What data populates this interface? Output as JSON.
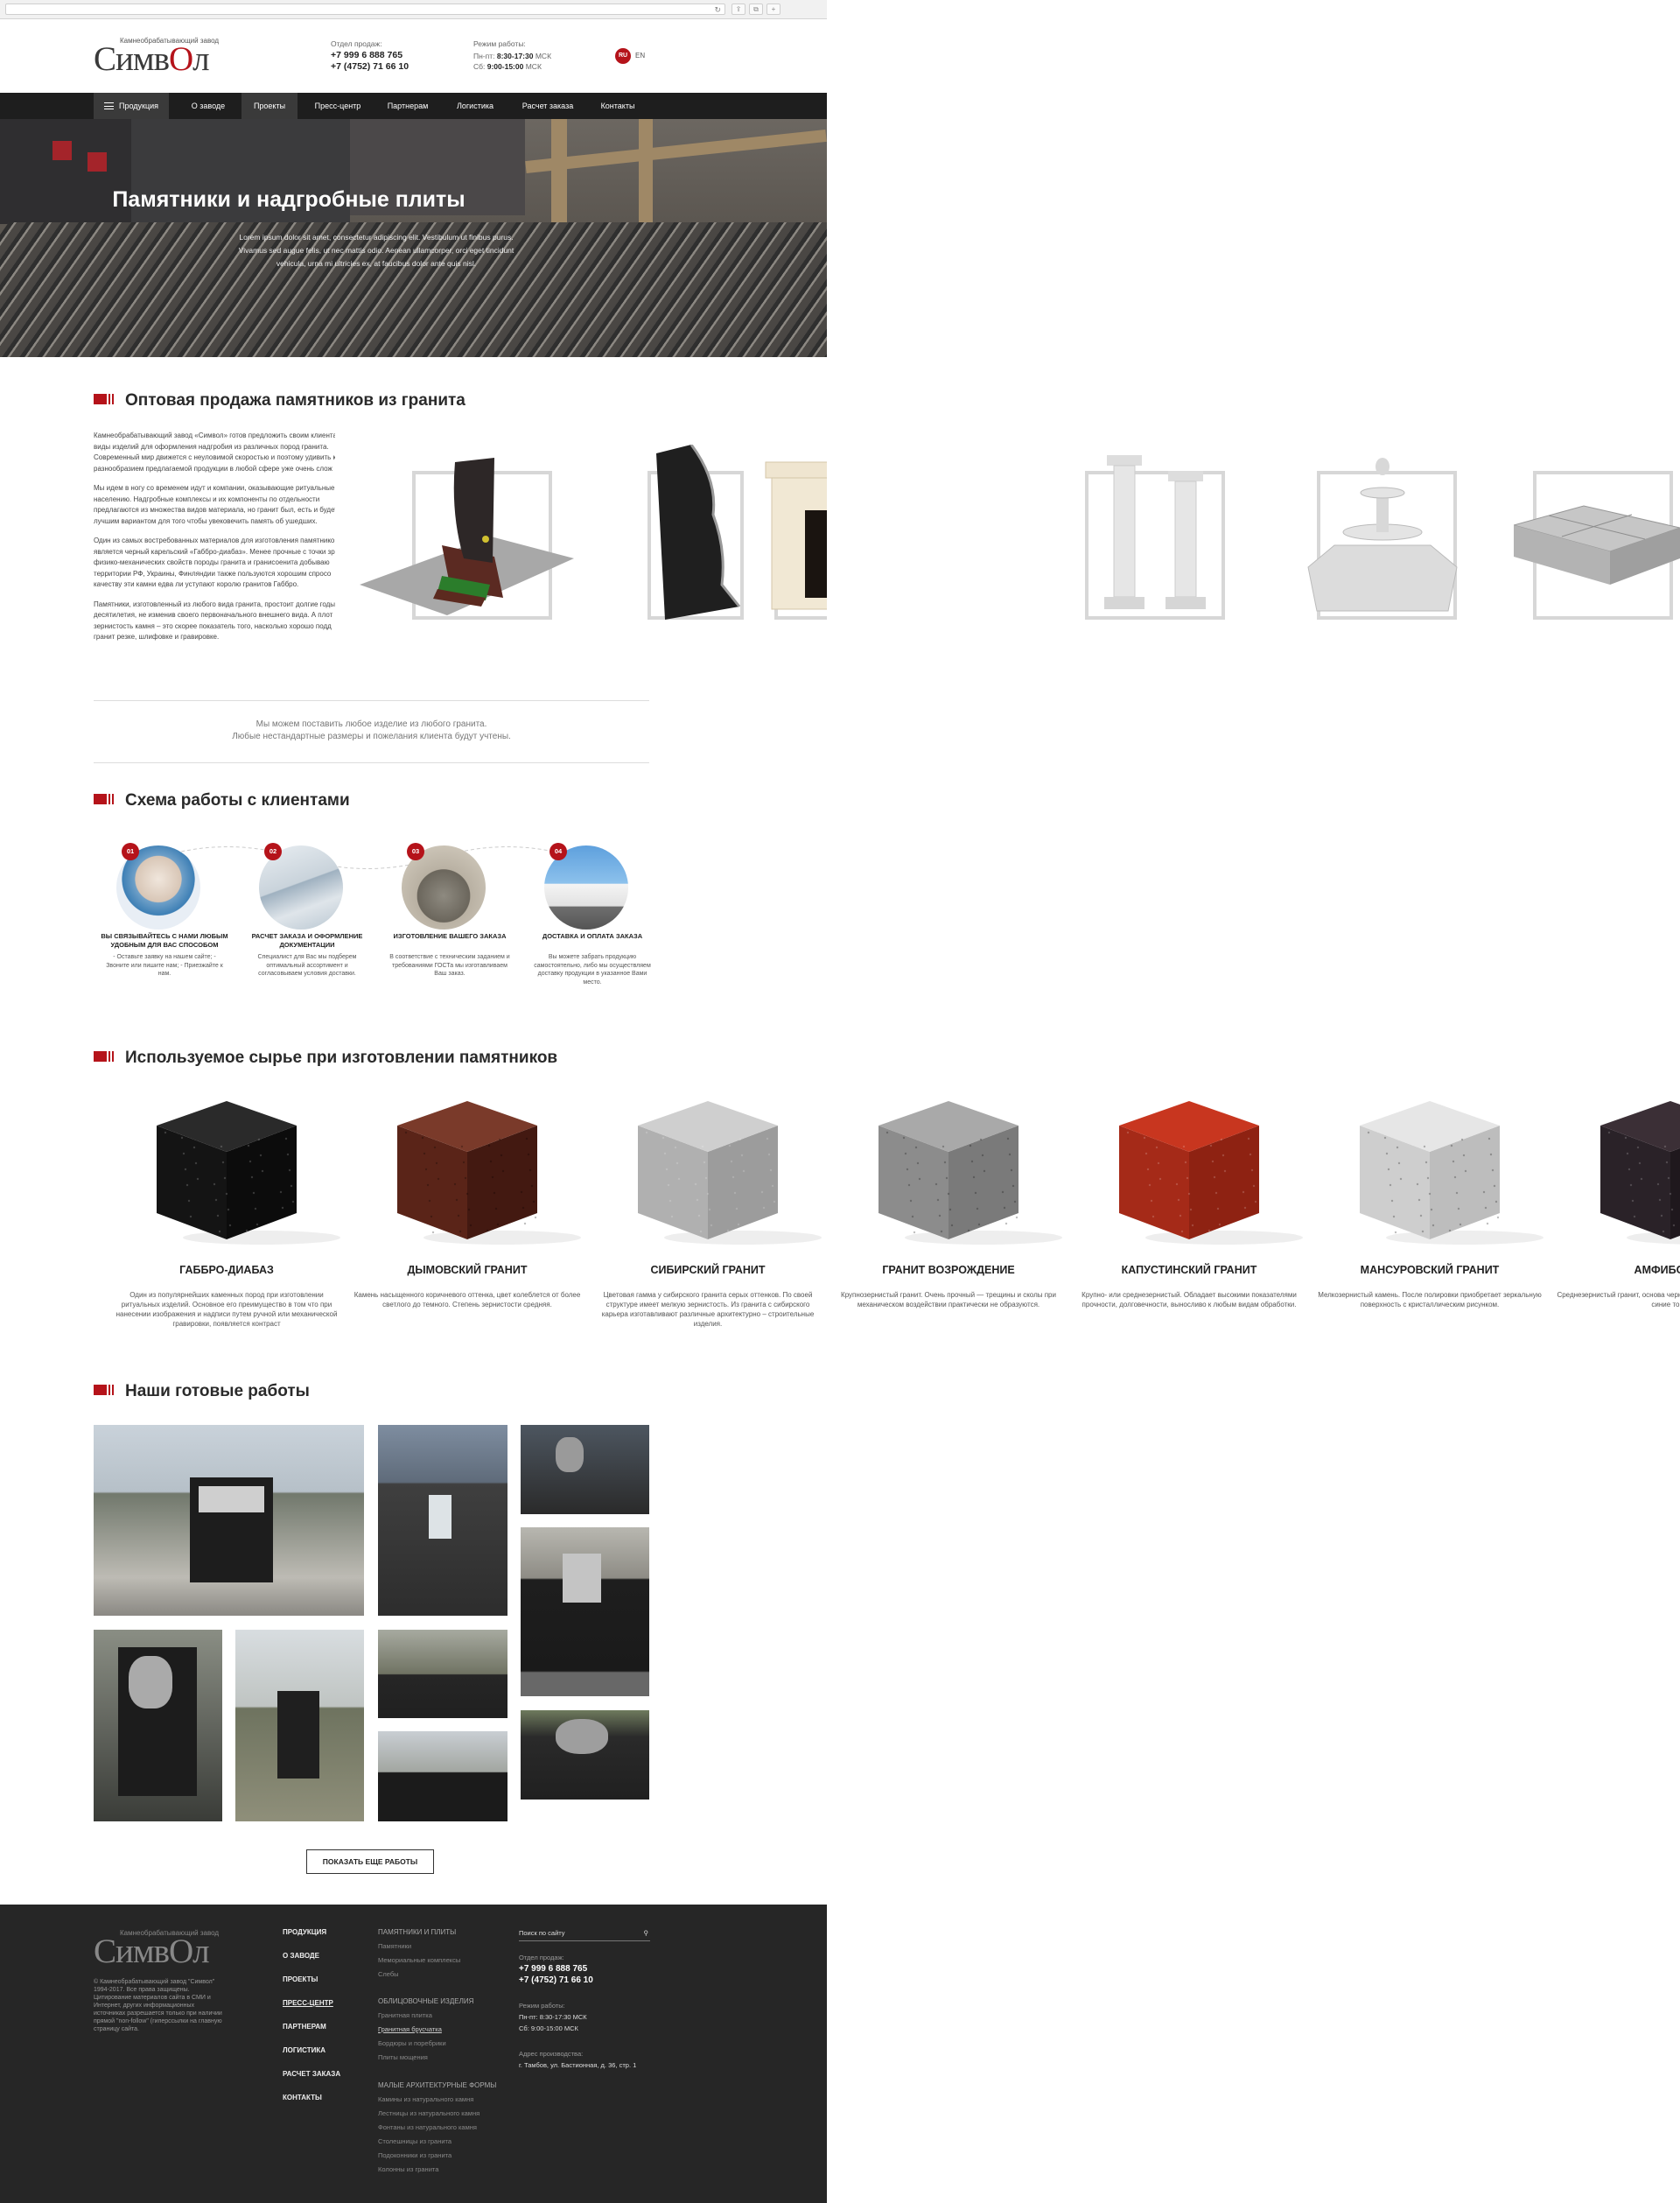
{
  "browser": {
    "reload": "↻",
    "btn1": "⇪",
    "btn2": "⧉",
    "btn3": "+"
  },
  "header": {
    "logo_sub": "Камнеобрабатывающий завод",
    "logo_main_1": "Симв",
    "logo_main_o": "О",
    "logo_main_2": "л",
    "sales_label": "Отдел продаж:",
    "phone1": "+7 999 6 888 765",
    "phone2": "+7 (4752) 71 66 10",
    "hours_label": "Режим работы:",
    "hours1_day": "Пн-пт:",
    "hours1_time": "8:30-17:30",
    "hours1_tz": "МСК",
    "hours2_day": "Сб:",
    "hours2_time": "9:00-15:00",
    "hours2_tz": "МСК",
    "lang_active": "RU",
    "lang_other": "EN"
  },
  "nav": {
    "items": [
      "Продукция",
      "О заводе",
      "Проекты",
      "Пресс-центр",
      "Партнерам",
      "Логистика",
      "Расчет заказа",
      "Контакты"
    ]
  },
  "hero": {
    "title": "Памятники и надгробные плиты",
    "text": "Lorem ipsum dolor sit amet, consectetur adipiscing elit. Vestibulum ut finibus purus. Vivamus sed augue felis, ut nec mattis odio. Aenean ullamcorper, orci eget tincidunt vehicula, urna mi ultricies ex, at faucibus dolor ante quis nisl."
  },
  "wholesale": {
    "title": "Оптовая продажа памятников из гранита",
    "paragraphs": [
      [
        "Камнеобрабатывающий завод «Символ» готов предложить своим клиента",
        "виды изделий для оформления надгробия из различных пород гранита.",
        "Современный мир движется с неуловимой скоростью и поэтому удивить к",
        "разнообразием предлагаемой продукции в любой сфере уже очень слож"
      ],
      [
        "Мы идем в ногу со временем идут и компании, оказывающие ритуальные",
        "населению. Надгробные комплексы и их компоненты по отдельности",
        "предлагаются из множества видов материала, но гранит был, есть и будет",
        "лучшим вариантом для того чтобы увековечить память об ушедших."
      ],
      [
        "Один из самых востребованных материалов для изготовления памятнико",
        "является черный карельский «Габбро-диабаз». Менее прочные с точки зр",
        "физико-механических свойств породы гранита и гранисоенита добываю",
        "территории РФ, Украины, Финляндии также пользуются хорошим спросо",
        "качеству эти камни едва ли уступают королю гранитов Габбро."
      ],
      [
        "Памятники, изготовленный из любого вида гранита, простоит долгие годы",
        "десятилетия, не изменив своего первоначального внешнего вида. А плот",
        "зернистость камня – это скорее показатель того, насколько хорошо подд",
        "гранит резке, шлифовке и гравировке."
      ]
    ],
    "note1": "Мы можем поставить любое изделие из любого гранита.",
    "note2": "Любые нестандартные размеры и пожелания клиента будут учтены."
  },
  "scheme": {
    "title": "Схема работы с клиентами",
    "steps": [
      {
        "num": "01",
        "title": "Вы связывайтесь с нами любым удобным для вас способом",
        "desc": "- Оставьте заявку на нашем сайте; - Звоните или пишите нам; - Приезжайте к нам."
      },
      {
        "num": "02",
        "title": "Расчет заказа и оформление документации",
        "desc": "Специалист для Вас мы подберем оптимальный ассортимент и согласовываем условия доставки."
      },
      {
        "num": "03",
        "title": "Изготовление вашего заказа",
        "desc": "В соответствие с техническим заданием и требованиями ГОСТа мы изготавливаем Ваш заказ."
      },
      {
        "num": "04",
        "title": "Доставка и оплата заказа",
        "desc": "Вы можете забрать продукцию самостоятельно, либо мы осуществляем доставку продукции в указанное Вами место."
      }
    ]
  },
  "materials": {
    "title": "Используемое сырье при изготовлении памятников",
    "items": [
      {
        "name": "ГАББРО-ДИАБАЗ",
        "desc": "Один из популярнейших каменных пород при изготовлении ритуальных изделий. Основное его преимущество в том что при нанесении изображения и надписи путем ручной или механической гравировки, появляется контраст",
        "top": "#2a2a2a",
        "left": "#141414",
        "right": "#0c0c0c"
      },
      {
        "name": "ДЫМОВСКИЙ ГРАНИТ",
        "desc": "Камень насыщенного коричневого оттенка, цвет колеблется от более светлого до темного. Степень зернистости средняя.",
        "top": "#7a3a2a",
        "left": "#5a2418",
        "right": "#431911"
      },
      {
        "name": "СИБИРСКИЙ ГРАНИТ",
        "desc": "Цветовая гамма у сибирского гранита серых оттенков. По своей структуре имеет мелкую зернистость. Из гранита с сибирского карьера изготавливают различные архитектурно – строительные изделия.",
        "top": "#cfcfcf",
        "left": "#b0b0b0",
        "right": "#9c9c9c"
      },
      {
        "name": "ГРАНИТ ВОЗРОЖДЕНИЕ",
        "desc": "Крупнозернистый гранит. Очень прочный — трещины и сколы при механическом воздействии практически не образуются.",
        "top": "#a9a9a9",
        "left": "#8c8c8c",
        "right": "#7a7a7a"
      },
      {
        "name": "КАПУСТИНСКИЙ ГРАНИТ",
        "desc": "Крупно- или среднезернистый. Обладает высокими показателями прочности, долговечности, выносливо к любым видам обработки.",
        "top": "#c8361f",
        "left": "#a52a18",
        "right": "#8e2212"
      },
      {
        "name": "МАНСУРОВСКИЙ ГРАНИТ",
        "desc": "Мелкозернистый камень. После полировки приобретает зеркальную поверхность с кристаллическим рисунком.",
        "top": "#e6e6e6",
        "left": "#cecece",
        "right": "#bdbdbd"
      },
      {
        "name": "АМФИБОЛИТ",
        "desc": "Среднезернистый гранит, основа черно-зеленые, красноватые, корич синие тона.",
        "top": "#3b2f36",
        "left": "#2a2228",
        "right": "#1f181d"
      }
    ]
  },
  "works": {
    "title": "Наши готовые работы",
    "button": "ПОКАЗАТЬ ЕЩЕ РАБОТЫ"
  },
  "footer": {
    "copyright": "© Камнеобрабатывающий завод \"Символ\" 1994-2017. Все права защищены. Цитирование материалов сайта в СМИ и Интернет, других информационных источниках разрешается только при наличии прямой \"non-follow\" (гиперссылки на главную страницу сайта.",
    "main_links": [
      "ПРОДУКЦИЯ",
      "О ЗАВОДЕ",
      "ПРОЕКТЫ",
      "ПРЕСС-ЦЕНТР",
      "ПАРТНЕРАМ",
      "ЛОГИСТИКА",
      "РАСЧЕТ ЗАКАЗА",
      "КОНТАКТЫ"
    ],
    "groups": [
      {
        "head": "ПАМЯТНИКИ И ПЛИТЫ",
        "items": [
          "Памятники",
          "Мемориальные комплексы",
          "Слебы"
        ]
      },
      {
        "head": "ОБЛИЦОВОЧНЫЕ ИЗДЕЛИЯ",
        "items": [
          "Гранитная плитка",
          "Гранитная брусчатка",
          "Бордюры и поребрики",
          "Плиты мощения"
        ]
      },
      {
        "head": "МАЛЫЕ АРХИТЕКТУРНЫЕ ФОРМЫ",
        "items": [
          "Камины из натурального камня",
          "Лестницы из натурального камня",
          "Фонтаны из натурального камня",
          "Столешницы из гранита",
          "Подоконники из гранита",
          "Колонны из гранита"
        ]
      }
    ],
    "search_placeholder": "Поиск по сайту",
    "search_icon": "⚲",
    "sales_label": "Отдел продаж:",
    "phone1": "+7 999 6 888 765",
    "phone2": "+7 (4752) 71 66 10",
    "hours_label": "Режим работы:",
    "hours1": "Пн-пт: 8:30-17:30 МСК",
    "hours2": "Сб: 9:00-15:00 МСК",
    "address_label": "Адрес производства:",
    "address": "г. Тамбов, ул. Бастионная, д. 36, стр. 1"
  },
  "colors": {
    "accent": "#b5131a",
    "nav_bg": "#1e1e1e",
    "footer_bg": "#262626"
  }
}
